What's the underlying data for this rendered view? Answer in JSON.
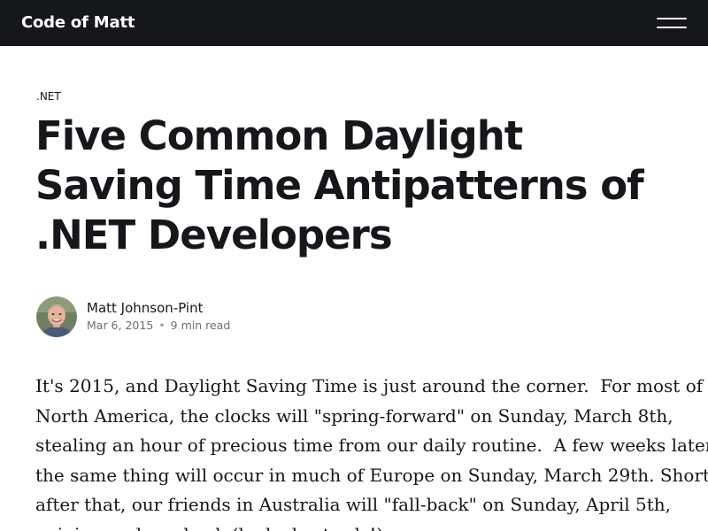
{
  "header": {
    "site_name": "Code of Matt",
    "menu_icon": "hamburger-menu-icon",
    "background_color": "#15171a"
  },
  "article": {
    "tag": ".NET",
    "title": "Five Common Daylight Saving Time Antipatterns of .NET Developers",
    "author": {
      "name": "Matt Johnson-Pint",
      "avatar_icon": "author-avatar-photo"
    },
    "date": "Mar 6, 2015",
    "separator": "•",
    "read_time": "9 min read",
    "body_lines": [
      "It's 2015, and Daylight Saving Time is just around the corner.  For most of",
      "North America, the clocks will \"spring-forward\" on Sunday, March 8th,",
      "stealing an hour of precious time from our daily routine.  A few weeks later,",
      "the same thing will occur in much of Europe on Sunday, March 29th. Shortly",
      "after that, our friends in Australia will \"fall-back\" on Sunday, April 5th,",
      "gaining an hour back (lucky bastards!)."
    ]
  }
}
